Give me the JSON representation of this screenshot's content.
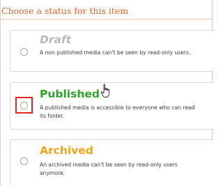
{
  "header": {
    "title": "Choose a status for this item"
  },
  "options": [
    {
      "key": "draft",
      "title": "Draft",
      "description": "A non published media can't be seen by read-only users.",
      "color": "#b9b9b9",
      "selected": false
    },
    {
      "key": "published",
      "title": "Published",
      "description": "A published media is accessible to everyone who can read its folder.",
      "color": "#2fa228",
      "selected": false,
      "focused": true
    },
    {
      "key": "archived",
      "title": "Archived",
      "description": "An archived media can't be seen by read-only users anymore.",
      "color": "#f0a41a",
      "selected": false
    }
  ],
  "accent_color": "#e1612a",
  "focus_color": "#e2261e",
  "cursor_icon": "hand-pointer-icon"
}
